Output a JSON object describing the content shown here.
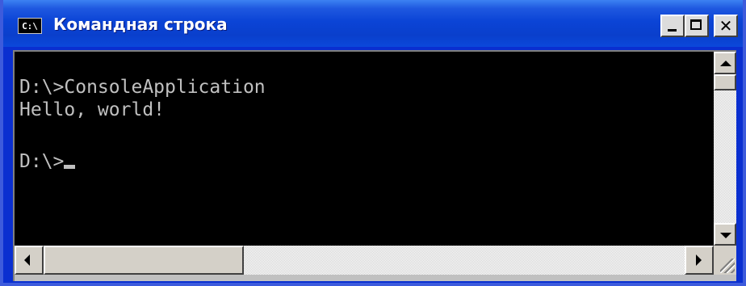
{
  "window": {
    "title": "Командная строка",
    "icon_label": "C:\\",
    "icon": "console-icon"
  },
  "controls": {
    "minimize_icon": "minimize-icon",
    "maximize_icon": "maximize-icon",
    "close_icon": "close-icon",
    "close_glyph": "✕"
  },
  "console": {
    "lines": [
      "D:\\>ConsoleApplication",
      "Hello, world!",
      "",
      "D:\\>"
    ],
    "text_color": "#c0c0c0",
    "background_color": "#000000"
  },
  "colors": {
    "title_bar": "#0a3fcc",
    "frame": "#3d5bdc",
    "scrollbar_button": "#d4d0c8"
  }
}
